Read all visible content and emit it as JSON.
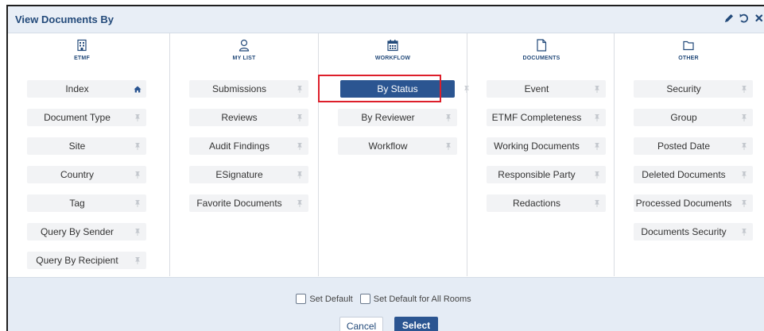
{
  "dialog": {
    "title": "View Documents By"
  },
  "columns": [
    {
      "label": "ETMF",
      "icon": "building-icon",
      "items": [
        {
          "label": "Index",
          "pin": "home-icon"
        },
        {
          "label": "Document Type",
          "pin": "pin-icon"
        },
        {
          "label": "Site",
          "pin": "pin-icon"
        },
        {
          "label": "Country",
          "pin": "pin-icon"
        },
        {
          "label": "Tag",
          "pin": "pin-icon"
        },
        {
          "label": "Query By Sender",
          "pin": "pin-icon"
        },
        {
          "label": "Query By Recipient",
          "pin": "pin-icon"
        }
      ]
    },
    {
      "label": "MY LIST",
      "icon": "user-icon",
      "items": [
        {
          "label": "Submissions",
          "pin": "pin-icon"
        },
        {
          "label": "Reviews",
          "pin": "pin-icon"
        },
        {
          "label": "Audit Findings",
          "pin": "pin-icon"
        },
        {
          "label": "ESignature",
          "pin": "pin-icon"
        },
        {
          "label": "Favorite Documents",
          "pin": "pin-icon"
        }
      ]
    },
    {
      "label": "WORKFLOW",
      "icon": "calendar-icon",
      "items": [
        {
          "label": "By Status",
          "pin": "pin-icon",
          "selected": true
        },
        {
          "label": "By Reviewer",
          "pin": "pin-icon"
        },
        {
          "label": "Workflow",
          "pin": "pin-icon"
        }
      ]
    },
    {
      "label": "DOCUMENTS",
      "icon": "document-icon",
      "items": [
        {
          "label": "Event",
          "pin": "pin-icon"
        },
        {
          "label": "ETMF Completeness",
          "pin": "pin-icon"
        },
        {
          "label": "Working Documents",
          "pin": "pin-icon"
        },
        {
          "label": "Responsible Party",
          "pin": "pin-icon"
        },
        {
          "label": "Redactions",
          "pin": "pin-icon"
        }
      ]
    },
    {
      "label": "OTHER",
      "icon": "folder-icon",
      "items": [
        {
          "label": "Security",
          "pin": "pin-icon"
        },
        {
          "label": "Group",
          "pin": "pin-icon"
        },
        {
          "label": "Posted Date",
          "pin": "pin-icon"
        },
        {
          "label": "Deleted Documents",
          "pin": "pin-icon"
        },
        {
          "label": "Processed Documents",
          "pin": "pin-icon"
        },
        {
          "label": "Documents Security",
          "pin": "pin-icon"
        }
      ]
    }
  ],
  "footer": {
    "set_default": "Set Default",
    "set_default_all": "Set Default for All Rooms",
    "cancel": "Cancel",
    "select": "Select"
  },
  "colors": {
    "accent": "#2b5591",
    "title": "#234a7a",
    "highlight": "#dd1f2a",
    "item_bg": "#f2f3f5"
  }
}
